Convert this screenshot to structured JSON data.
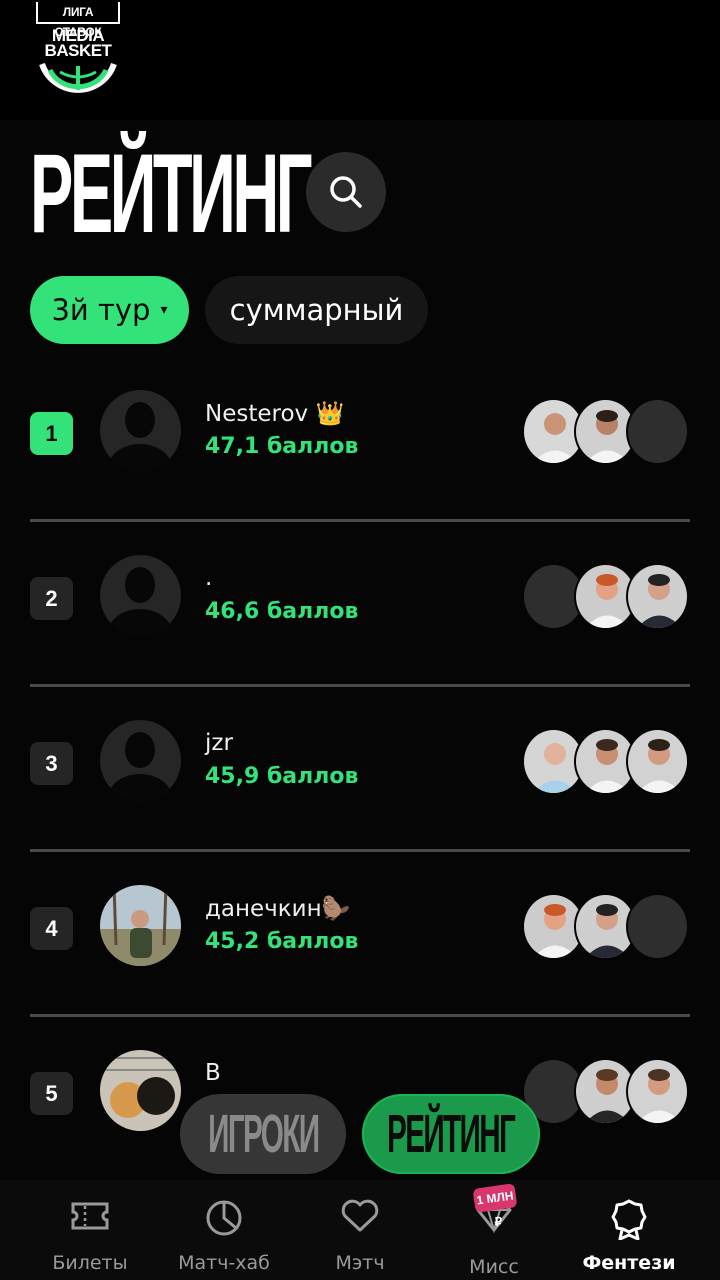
{
  "logo": {
    "top_text": "ЛИГА СТАВОК",
    "main_line1": "MEDIA",
    "main_line2": "BASKET"
  },
  "page": {
    "title": "РЕЙТИНГ"
  },
  "filters": {
    "round": "3й тур",
    "round_arrow": "▾",
    "total": "суммарный"
  },
  "leaderboard": [
    {
      "rank": "1",
      "name": "Nesterov 👑",
      "points": "47,1 баллов",
      "avatar": "silhouette",
      "players": [
        "player-photo",
        "player-photo",
        "empty"
      ]
    },
    {
      "rank": "2",
      "name": ".",
      "points": "46,6 баллов",
      "avatar": "silhouette",
      "players": [
        "empty",
        "player-photo",
        "player-photo"
      ]
    },
    {
      "rank": "3",
      "name": "jzr",
      "points": "45,9 баллов",
      "avatar": "silhouette",
      "players": [
        "player-photo",
        "player-photo",
        "player-photo"
      ]
    },
    {
      "rank": "4",
      "name": "данечкин🦫",
      "points": "45,2 баллов",
      "avatar": "photo-outdoor",
      "players": [
        "player-photo",
        "player-photo",
        "empty"
      ]
    },
    {
      "rank": "5",
      "name": "B",
      "points": "",
      "avatar": "photo-dogs",
      "players": [
        "empty",
        "player-photo",
        "player-photo"
      ]
    }
  ],
  "switcher": {
    "players": "ИГРОКИ",
    "rating": "РЕЙТИНГ"
  },
  "nav": [
    {
      "label": "Билеты",
      "icon": "ticket-icon"
    },
    {
      "label": "Матч-хаб",
      "icon": "pie-chart-icon"
    },
    {
      "label": "Мэтч",
      "icon": "heart-icon"
    },
    {
      "label": "Мисс",
      "icon": "diamond-icon",
      "badge": "1 МЛН ₽"
    },
    {
      "label": "Фентези",
      "icon": "medal-icon",
      "active": true
    }
  ],
  "colors": {
    "accent": "#34e27a",
    "background": "#050505",
    "badge": "#d9366f"
  }
}
